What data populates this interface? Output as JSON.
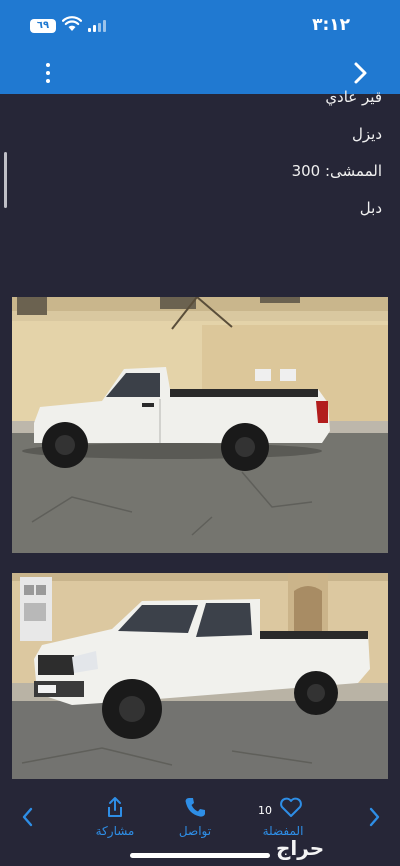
{
  "status_bar": {
    "time": "٣:١٢",
    "battery_level": "٦٩"
  },
  "listing": {
    "details": [
      "قير عادي",
      "ديزل",
      "الممشى: 300",
      "دبل"
    ]
  },
  "bottom_nav": {
    "share_label": "مشاركة",
    "contact_label": "تواصل",
    "favorite_label": "المفضلة",
    "favorite_count": "10"
  },
  "brand": {
    "logo_text": "حراج"
  },
  "colors": {
    "header": "#2079d1",
    "background": "#262637",
    "accent": "#2e8ee6"
  },
  "icons": [
    "wifi-icon",
    "signal-icon",
    "more-icon",
    "chevron-right-icon",
    "share-icon",
    "phone-icon",
    "heart-icon",
    "chevron-left-icon"
  ]
}
